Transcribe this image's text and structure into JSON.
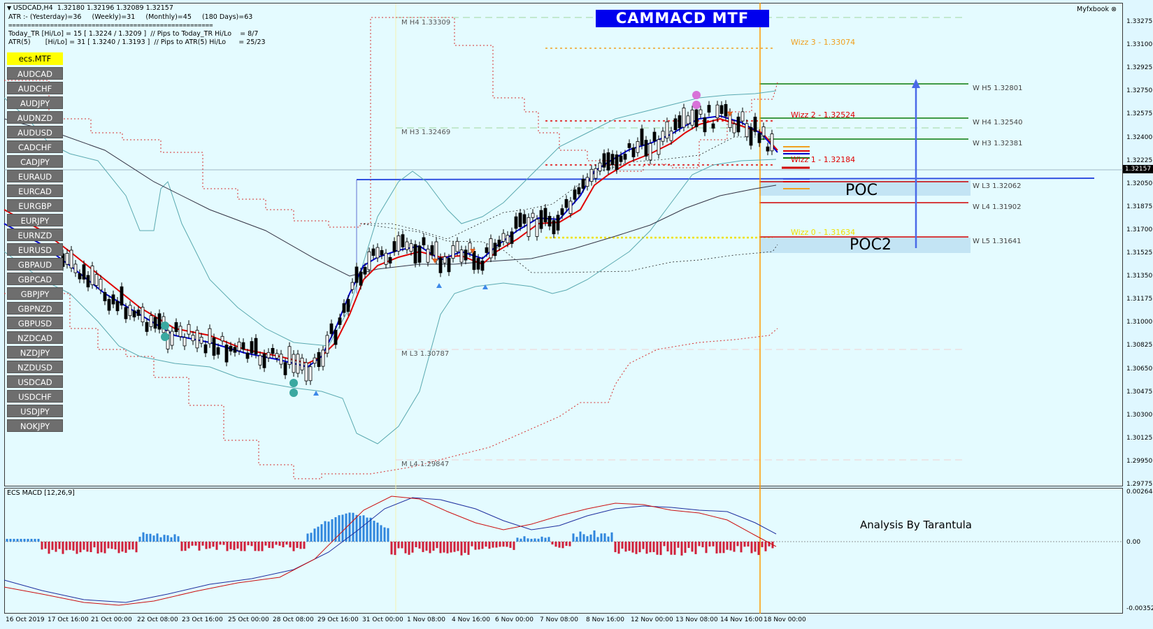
{
  "header": {
    "symbol_line": "USDCAD,H4  1.32180 1.32196 1.32089 1.32157",
    "atr_line": "ATR :- (Yesterday)=36     (Weekly)=31     (Monthly)=45     (180 Days)=63",
    "separator": "======================================================",
    "today_tr_line": "Today_TR [Hi/Lo] = 15 [ 1.3224 / 1.3209 ]  // Pips to Today_TR Hi/Lo    = 8/7",
    "atr5_line": "ATR(5)       [Hi/Lo] = 31 [ 1.3240 / 1.3193 ]  // Pips to ATR(5) Hi/Lo      = 25/23"
  },
  "symbol_list": {
    "active": "ecs.MTF",
    "items": [
      "AUDCAD",
      "AUDCHF",
      "AUDJPY",
      "AUDNZD",
      "AUDUSD",
      "CADCHF",
      "CADJPY",
      "EURAUD",
      "EURCAD",
      "EURGBP",
      "EURJPY",
      "EURNZD",
      "EURUSD",
      "GBPAUD",
      "GBPCAD",
      "GBPJPY",
      "GBPNZD",
      "GBPUSD",
      "NZDCAD",
      "NZDJPY",
      "NZDUSD",
      "USDCAD",
      "USDCHF",
      "USDJPY",
      "NOKJPY"
    ]
  },
  "banner": "CAMMACD MTF",
  "myfxbook": "Myfxbook ⊗",
  "current_price": "1.32157",
  "price_ticks": [
    "1.33275",
    "1.33100",
    "1.32925",
    "1.32750",
    "1.32575",
    "1.32400",
    "1.32225",
    "1.32050",
    "1.31875",
    "1.31700",
    "1.31525",
    "1.31350",
    "1.31175",
    "1.31000",
    "1.30825",
    "1.30650",
    "1.30475",
    "1.30300",
    "1.30125",
    "1.29950",
    "1.29775"
  ],
  "time_labels": [
    "16 Oct 2019",
    "17 Oct 16:00",
    "21 Oct 00:00",
    "22 Oct 08:00",
    "23 Oct 16:00",
    "25 Oct 00:00",
    "28 Oct 08:00",
    "29 Oct 16:00",
    "31 Oct 00:00",
    "1 Nov 08:00",
    "4 Nov 16:00",
    "6 Nov 00:00",
    "7 Nov 08:00",
    "8 Nov 16:00",
    "12 Nov 00:00",
    "13 Nov 08:00",
    "14 Nov 16:00",
    "18 Nov 00:00"
  ],
  "levels": {
    "wizz3": "Wizz 3 - 1.33074",
    "wizz2": "Wizz 2 - 1.32524",
    "wizz1": "Wizz 1 - 1.32184",
    "wizz0": "Wizz 0 - 1.31634",
    "m_h4": "M  H4 1.33309",
    "m_h3": "M  H3 1.32469",
    "m_l3": "M  L3 1.30787",
    "m_l4": "M  L4 1.29847",
    "w_h5": "W  H5 1.32801",
    "w_h4": "W  H4 1.32540",
    "w_h3": "W  H3 1.32381",
    "w_l3": "W  L3 1.32062",
    "w_l4": "W  L4 1.31902",
    "w_l5": "W  L5 1.31641"
  },
  "poc_labels": {
    "poc": "POC",
    "poc2": "POC2"
  },
  "macd": {
    "title": "ECS MACD [12,26,9]",
    "ticks": [
      "0.0026445",
      "0.00",
      "-0.003524"
    ],
    "annotation": "Analysis By Tarantula"
  },
  "colors": {
    "background": "#e4fbff",
    "ema_red": "#e00000",
    "ema_blue": "#0000cc",
    "bollinger": "#5aa9b0",
    "banner": "#0000ee",
    "vertical_orange": "#ff9900",
    "histogram_up": "#2f86dd",
    "histogram_down": "#d0203a"
  }
}
